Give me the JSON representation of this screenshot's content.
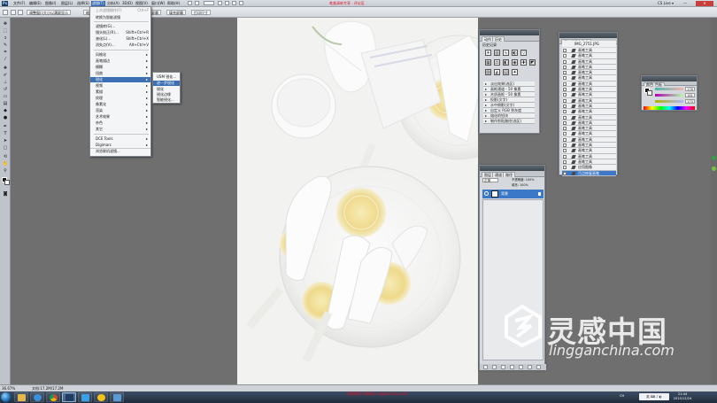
{
  "app": {
    "logo_text": "Ps",
    "menus": [
      "文件(F)",
      "编辑(E)",
      "图像(I)",
      "图层(L)",
      "选择(S)",
      "滤镜(T)",
      "分析(A)",
      "3D(D)",
      "视图(V)",
      "窗口(W)",
      "帮助(H)"
    ],
    "active_menu": "滤镜(T)",
    "title_banner": "唯美清新专享 · 评论区",
    "window_controls": [
      "CS Live ▾",
      "—",
      "✕"
    ]
  },
  "options_bar": {
    "buttons": [
      "调整窗口大小以满屏显示",
      "缩放所有窗口",
      "实际像素",
      "适合屏幕",
      "填充屏幕",
      "打印尺寸"
    ]
  },
  "filter_menu": {
    "items": [
      {
        "label": "上次滤镜操作(F)",
        "shortcut": "Ctrl+F"
      },
      {
        "label": "转换为智能滤镜",
        "shortcut": ""
      },
      {
        "sep": true
      },
      {
        "label": "滤镜库(G)...",
        "shortcut": ""
      },
      {
        "label": "镜头校正(R)...",
        "shortcut": "Shift+Ctrl+R"
      },
      {
        "label": "液化(L)...",
        "shortcut": "Shift+Ctrl+X"
      },
      {
        "label": "消失点(V)...",
        "shortcut": "Alt+Ctrl+V"
      },
      {
        "sep": true
      },
      {
        "label": "风格化",
        "arrow": true
      },
      {
        "label": "画笔描边",
        "arrow": true
      },
      {
        "label": "模糊",
        "arrow": true
      },
      {
        "label": "扭曲",
        "arrow": true
      },
      {
        "label": "锐化",
        "arrow": true,
        "highlight": true
      },
      {
        "label": "视频",
        "arrow": true
      },
      {
        "label": "素描",
        "arrow": true
      },
      {
        "label": "纹理",
        "arrow": true
      },
      {
        "label": "像素化",
        "arrow": true
      },
      {
        "label": "渲染",
        "arrow": true
      },
      {
        "label": "艺术效果",
        "arrow": true
      },
      {
        "label": "杂色",
        "arrow": true
      },
      {
        "label": "其它",
        "arrow": true
      },
      {
        "sep": true
      },
      {
        "label": "DCE Tools",
        "arrow": true
      },
      {
        "label": "Digimarc",
        "arrow": true
      },
      {
        "label": "Imagenomic",
        "arrow": true
      },
      {
        "sep": true
      },
      {
        "label": "浏览联机滤镜...",
        "shortcut": ""
      }
    ]
  },
  "submenu": {
    "items": [
      {
        "label": "USM 锐化...",
        "highlight": false
      },
      {
        "label": "进一步锐化",
        "highlight": true
      },
      {
        "label": "锐化",
        "highlight": false
      },
      {
        "label": "锐化边缘",
        "highlight": false
      },
      {
        "label": "智能锐化...",
        "highlight": false
      }
    ]
  },
  "actions_panel": {
    "tabs": [
      "动作",
      "历史"
    ],
    "title": "历史记录",
    "rows": [
      "淡出效果(选区)",
      "画框通道 - 50 像素",
      "木质画框 - 50 像素",
      "投影(文字)",
      "水中倒影(文字)",
      "自定义 RGB 到灰度",
      "熔化的铅块",
      "制作剪贴路径(选区)"
    ]
  },
  "history_panel": {
    "tabs": [
      "历史记录",
      "动作"
    ],
    "source": "IMG_2751.JPG",
    "rows": [
      "画笔工具",
      "画笔工具",
      "画笔工具",
      "画笔工具",
      "画笔工具",
      "画笔工具",
      "画笔工具",
      "画笔工具",
      "画笔工具",
      "画笔工具",
      "画笔工具",
      "画笔工具",
      "画笔工具",
      "画笔工具",
      "画笔工具",
      "画笔工具",
      "画笔工具",
      "画笔工具",
      "画笔工具",
      "画笔工具",
      "画笔工具",
      "应用图像",
      "污点修复画笔"
    ],
    "selected_index": 22
  },
  "color_panel": {
    "tabs": [
      "颜色",
      "色板"
    ],
    "R": "176",
    "G": "181",
    "B": "173"
  },
  "layers_panel": {
    "tabs": [
      "图层",
      "通道",
      "路径"
    ],
    "blend_mode": "正常",
    "opacity_label": "不透明度: 100%",
    "fill_label": "填充: 100%",
    "layer_name": "背景"
  },
  "watermark": {
    "text": "灵感中国",
    "url": "lingganchina.com"
  },
  "status": {
    "zoom": "36.67%",
    "doc": "文档:17.2M/17.2M",
    "caption": "原版素材下载地址 lingganchina.com"
  },
  "taskbar": {
    "tray_lang": "CH",
    "tray_badge": "英 ⌨ ♪ ◐",
    "time": "21:44",
    "date": "2015/12/24"
  },
  "colors": {
    "menu_highlight": "#3d6fb5",
    "selection_blue": "#3c78c8",
    "banner_red": "#e0142b"
  }
}
